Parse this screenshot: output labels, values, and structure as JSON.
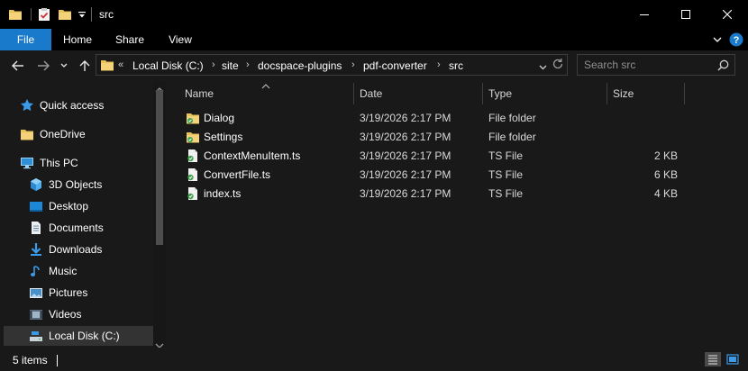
{
  "window": {
    "title": "src",
    "minimize_icon": "minimize-icon",
    "maximize_icon": "maximize-icon",
    "close_icon": "close-icon"
  },
  "ribbon": {
    "tabs": [
      {
        "label": "File",
        "active": true
      },
      {
        "label": "Home"
      },
      {
        "label": "Share"
      },
      {
        "label": "View"
      }
    ],
    "accent": "#1979ca"
  },
  "address": {
    "overflow": "«",
    "crumbs": [
      "Local Disk (C:)",
      "site",
      "docspace-plugins",
      "pdf-converter",
      "src"
    ],
    "search_placeholder": "Search src"
  },
  "nav": {
    "items": [
      {
        "label": "Quick access",
        "icon": "star-icon"
      },
      {
        "label": "OneDrive",
        "icon": "folder-icon"
      },
      {
        "label": "This PC",
        "icon": "computer-icon"
      },
      {
        "label": "3D Objects",
        "icon": "cube-icon"
      },
      {
        "label": "Desktop",
        "icon": "desktop-icon"
      },
      {
        "label": "Documents",
        "icon": "documents-icon"
      },
      {
        "label": "Downloads",
        "icon": "download-icon"
      },
      {
        "label": "Music",
        "icon": "music-icon"
      },
      {
        "label": "Pictures",
        "icon": "pictures-icon"
      },
      {
        "label": "Videos",
        "icon": "videos-icon"
      },
      {
        "label": "Local Disk (C:)",
        "icon": "drive-icon",
        "selected": true
      }
    ]
  },
  "columns": {
    "name": "Name",
    "date": "Date",
    "type": "Type",
    "size": "Size"
  },
  "files": [
    {
      "name": "Dialog",
      "date": "3/19/2026 2:17 PM",
      "type": "File folder",
      "size": "",
      "icon": "folder-icon"
    },
    {
      "name": "Settings",
      "date": "3/19/2026 2:17 PM",
      "type": "File folder",
      "size": "",
      "icon": "folder-icon"
    },
    {
      "name": "ContextMenuItem.ts",
      "date": "3/19/2026 2:17 PM",
      "type": "TS File",
      "size": "2 KB",
      "icon": "ts-file-icon"
    },
    {
      "name": "ConvertFile.ts",
      "date": "3/19/2026 2:17 PM",
      "type": "TS File",
      "size": "6 KB",
      "icon": "ts-file-icon"
    },
    {
      "name": "index.ts",
      "date": "3/19/2026 2:17 PM",
      "type": "TS File",
      "size": "4 KB",
      "icon": "ts-file-icon"
    }
  ],
  "status": {
    "count": "5 items"
  }
}
